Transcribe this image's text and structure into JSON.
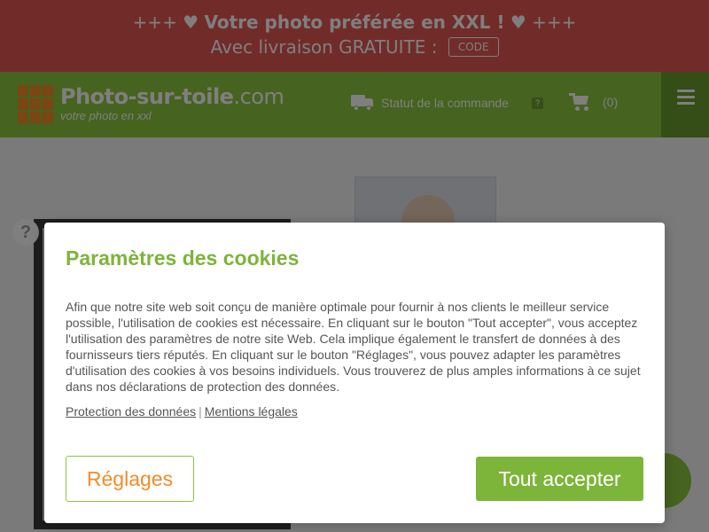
{
  "promo": {
    "line1_prefix": "+++ ♥ ",
    "line1_bold": "Votre photo préférée en XXL !",
    "line1_suffix": " ♥ +++",
    "line2": "Avec livraison GRATUITE :",
    "code_button": "CODE"
  },
  "header": {
    "logo_name": "Photo-sur-toile",
    "logo_tld": ".com",
    "logo_tagline": "votre photo en xxl",
    "order_status_label": "Statut de la commande",
    "order_status_help": "?",
    "cart_count": "(0)"
  },
  "page": {
    "help_label": "?"
  },
  "cookie_modal": {
    "title": "Paramètres des cookies",
    "body": "Afin que notre site web soit conçu de manière optimale pour fournir à nos clients le meilleur service possible, l'utilisation de cookies est nécessaire. En cliquant sur le bouton \"Tout accepter\", vous acceptez l'utilisation des paramètres de notre site Web. Cela implique également le transfert de données à des fournisseurs tiers réputés. En cliquant sur le bouton \"Réglages\", vous pouvez adapter les paramètres d'utilisation des cookies à vos besoins individuels. Vous trouverez de plus amples informations à ce sujet dans nos déclarations de protection des données.",
    "link_privacy": "Protection des données",
    "link_separator": "|",
    "link_legal": "Mentions légales",
    "settings_button": "Réglages",
    "accept_button": "Tout accepter"
  },
  "colors": {
    "promo_bg": "#e35852",
    "header_bg": "#8dc63f",
    "accent_green": "#7db43a",
    "accent_orange": "#f28c28"
  }
}
